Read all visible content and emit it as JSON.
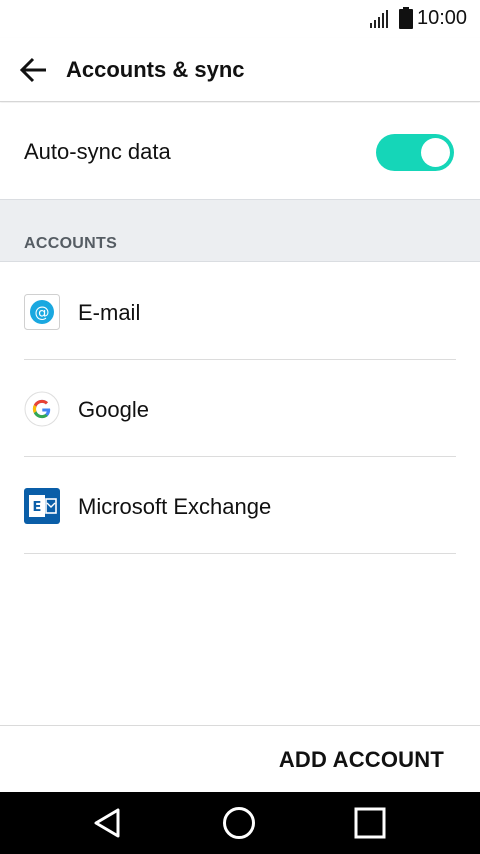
{
  "status_bar": {
    "time": "10:00",
    "icons": [
      "signal-icon",
      "battery-icon"
    ]
  },
  "app_bar": {
    "back_icon": "back-arrow-icon",
    "title": "Accounts & sync"
  },
  "auto_sync": {
    "label": "Auto-sync data",
    "enabled": true,
    "accent_color": "#15d6b8"
  },
  "accounts_section": {
    "header": "ACCOUNTS",
    "items": [
      {
        "label": "E-mail",
        "icon": "email-at-icon"
      },
      {
        "label": "Google",
        "icon": "google-g-icon"
      },
      {
        "label": "Microsoft Exchange",
        "icon": "exchange-icon"
      }
    ]
  },
  "footer": {
    "add_account_label": "ADD ACCOUNT"
  },
  "nav_bar": {
    "icons": [
      "back-triangle-icon",
      "home-circle-icon",
      "recents-square-icon"
    ]
  }
}
